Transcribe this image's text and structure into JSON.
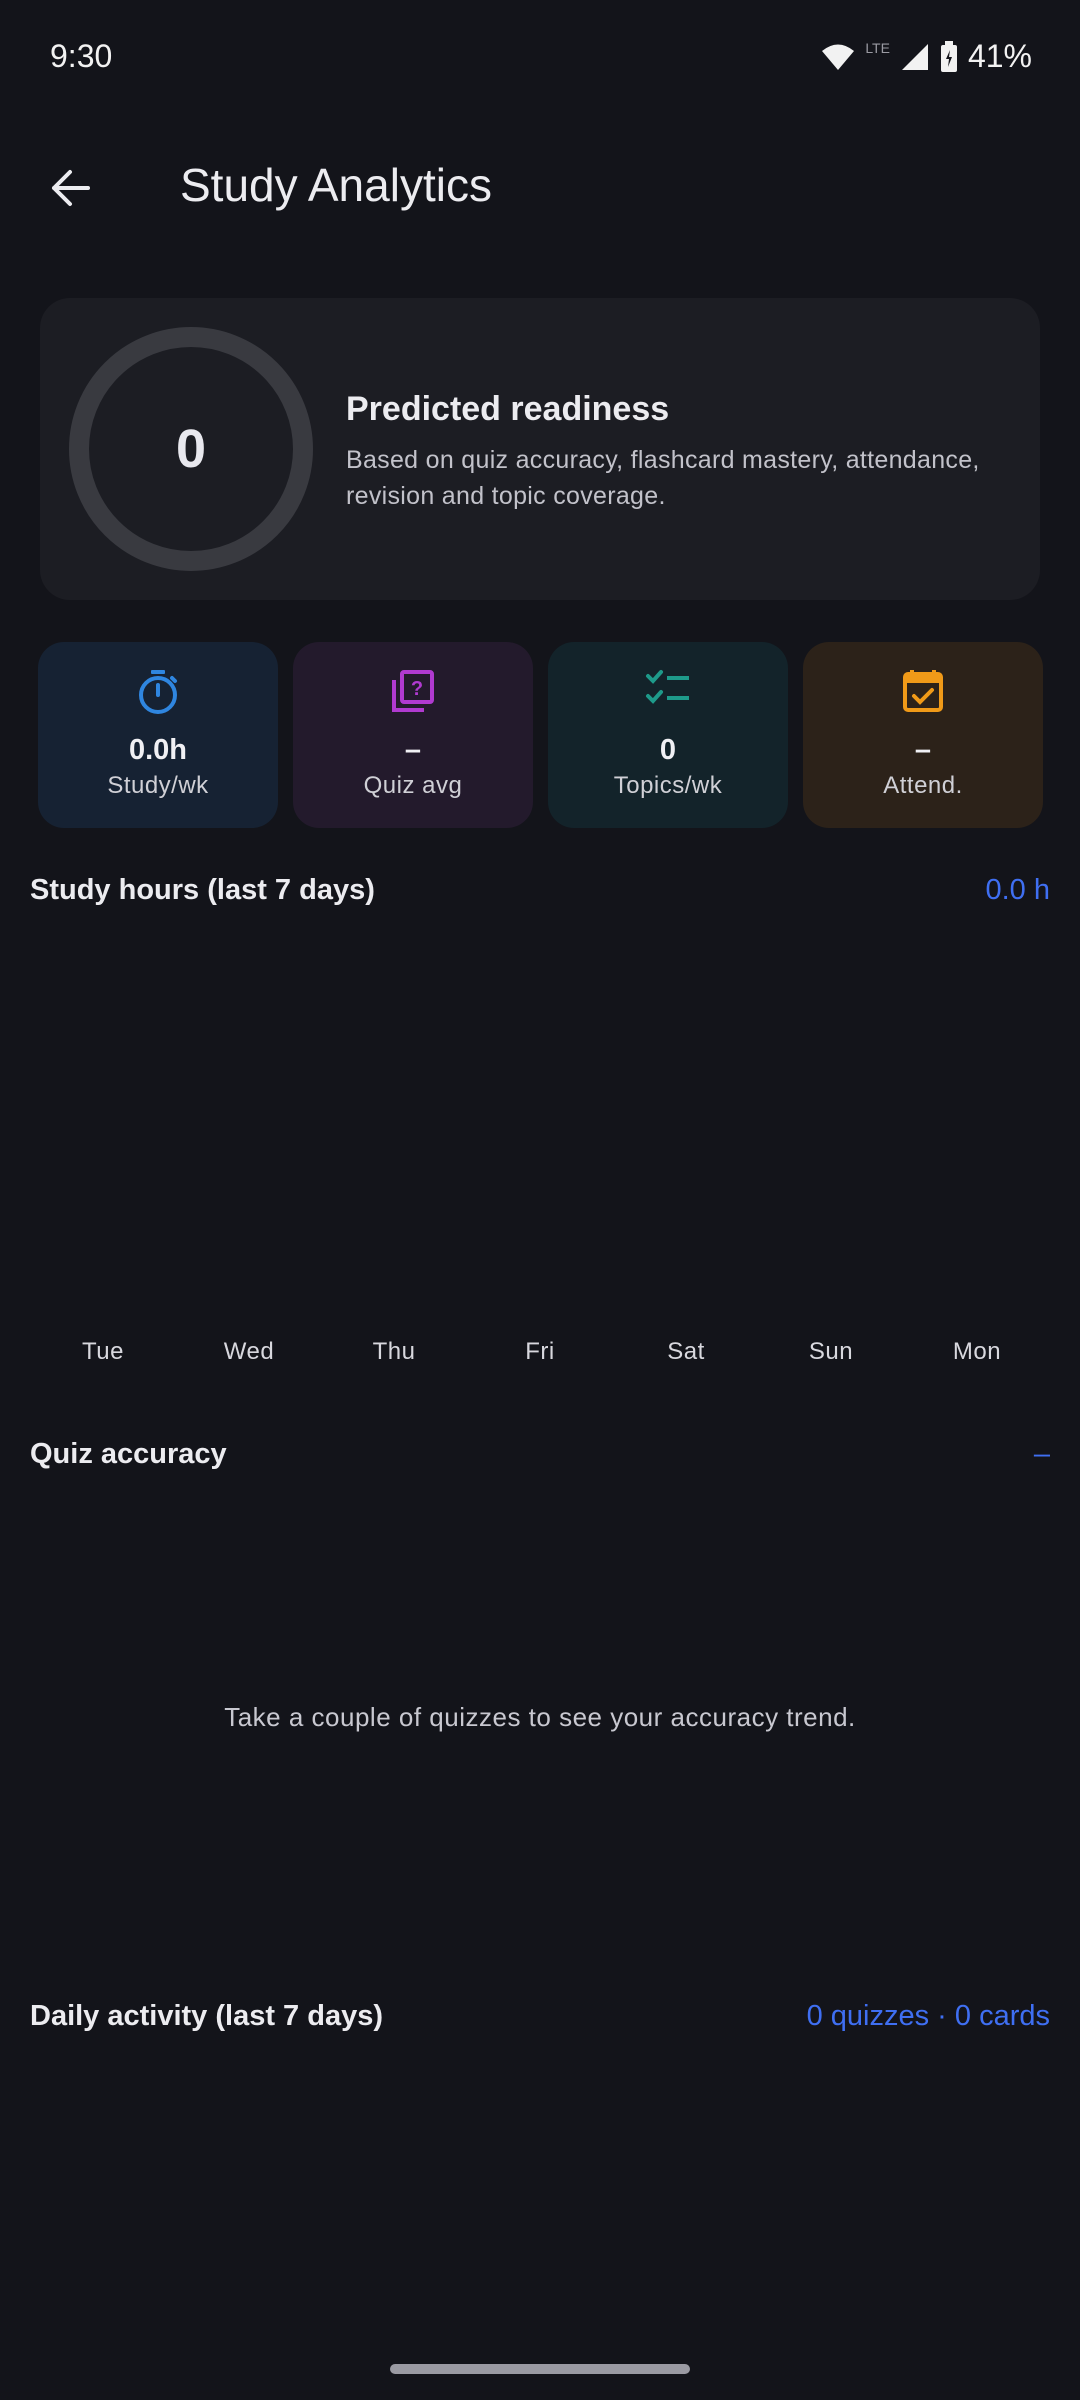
{
  "status_bar": {
    "time": "9:30",
    "battery": "41%"
  },
  "app_bar": {
    "title": "Study Analytics"
  },
  "readiness": {
    "value": "0",
    "title": "Predicted readiness",
    "description": "Based on quiz accuracy, flashcard mastery, attendance, revision and topic coverage."
  },
  "stats": [
    {
      "value": "0.0h",
      "label": "Study/wk",
      "icon": "timer-icon",
      "color": "#2f86e0"
    },
    {
      "value": "–",
      "label": "Quiz avg",
      "icon": "quiz-icon",
      "color": "#b03ad0"
    },
    {
      "value": "0",
      "label": "Topics/wk",
      "icon": "checklist-icon",
      "color": "#1e9a8a"
    },
    {
      "value": "–",
      "label": "Attend.",
      "icon": "calendar-check-icon",
      "color": "#f09a18"
    }
  ],
  "study_hours": {
    "title": "Study hours (last 7 days)",
    "total": "0.0 h",
    "days": [
      "Tue",
      "Wed",
      "Thu",
      "Fri",
      "Sat",
      "Sun",
      "Mon"
    ]
  },
  "quiz_accuracy": {
    "title": "Quiz accuracy",
    "value": "–",
    "empty_message": "Take a couple of quizzes to see your accuracy trend."
  },
  "daily_activity": {
    "title": "Daily activity (last 7 days)",
    "summary": "0 quizzes · 0 cards"
  },
  "colors": {
    "accent": "#3f6ff2",
    "background": "#13141a",
    "card": "#1c1d23"
  }
}
